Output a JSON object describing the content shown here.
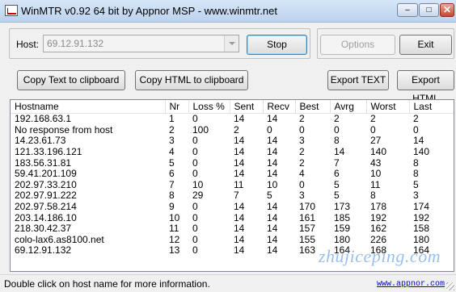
{
  "window": {
    "title": "WinMTR v0.92 64 bit by Appnor MSP - www.winmtr.net",
    "controls": {
      "minimize": "–",
      "maximize": "□",
      "close": "✕"
    }
  },
  "host": {
    "label": "Host:",
    "value": "69.12.91.132"
  },
  "buttons": {
    "stop": "Stop",
    "options": "Options",
    "exit": "Exit",
    "copy_text": "Copy Text to clipboard",
    "copy_html": "Copy HTML to clipboard",
    "export_text": "Export TEXT",
    "export_html": "Export HTML"
  },
  "table": {
    "columns": [
      "Hostname",
      "Nr",
      "Loss %",
      "Sent",
      "Recv",
      "Best",
      "Avrg",
      "Worst",
      "Last"
    ],
    "rows": [
      [
        "192.168.63.1",
        "1",
        "0",
        "14",
        "14",
        "2",
        "2",
        "2",
        "2"
      ],
      [
        "No response from host",
        "2",
        "100",
        "2",
        "0",
        "0",
        "0",
        "0",
        "0"
      ],
      [
        "14.23.61.73",
        "3",
        "0",
        "14",
        "14",
        "3",
        "8",
        "27",
        "14"
      ],
      [
        "121.33.196.121",
        "4",
        "0",
        "14",
        "14",
        "2",
        "14",
        "140",
        "140"
      ],
      [
        "183.56.31.81",
        "5",
        "0",
        "14",
        "14",
        "2",
        "7",
        "43",
        "8"
      ],
      [
        "59.41.201.109",
        "6",
        "0",
        "14",
        "14",
        "4",
        "6",
        "10",
        "8"
      ],
      [
        "202.97.33.210",
        "7",
        "10",
        "11",
        "10",
        "0",
        "5",
        "11",
        "5"
      ],
      [
        "202.97.91.222",
        "8",
        "29",
        "7",
        "5",
        "3",
        "5",
        "8",
        "3"
      ],
      [
        "202.97.58.214",
        "9",
        "0",
        "14",
        "14",
        "170",
        "173",
        "178",
        "174"
      ],
      [
        "203.14.186.10",
        "10",
        "0",
        "14",
        "14",
        "161",
        "185",
        "192",
        "192"
      ],
      [
        "218.30.42.37",
        "11",
        "0",
        "14",
        "14",
        "157",
        "159",
        "162",
        "158"
      ],
      [
        "colo-lax6.as8100.net",
        "12",
        "0",
        "14",
        "14",
        "155",
        "180",
        "226",
        "180"
      ],
      [
        "69.12.91.132",
        "13",
        "0",
        "14",
        "14",
        "163",
        "164",
        "168",
        "164"
      ]
    ]
  },
  "status": {
    "text": "Double click on host name for more information.",
    "link": "www.appnor.com"
  },
  "watermark": "zhujiceping.com"
}
